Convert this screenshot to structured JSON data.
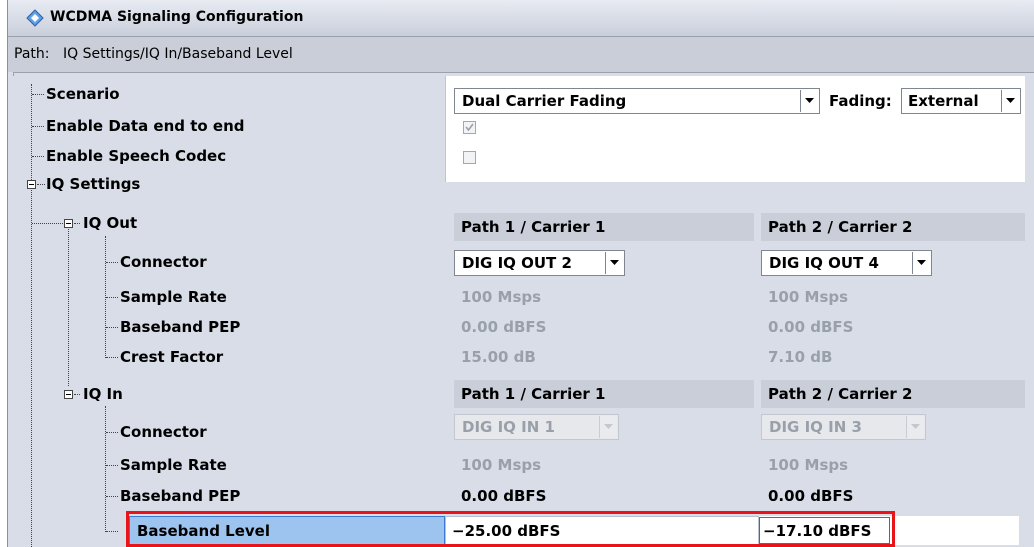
{
  "window": {
    "title": "WCDMA Signaling Configuration"
  },
  "path": {
    "label": "Path:",
    "value": "IQ Settings/IQ In/Baseband Level"
  },
  "tree": {
    "scenario": "Scenario",
    "enable_data": "Enable Data end to end",
    "enable_speech": "Enable Speech Codec",
    "iq_settings": "IQ Settings",
    "iq_out": "IQ Out",
    "connector": "Connector",
    "sample_rate": "Sample Rate",
    "baseband_pep": "Baseband PEP",
    "crest_factor": "Crest Factor",
    "iq_in": "IQ In",
    "baseband_level": "Baseband Level"
  },
  "scenario": {
    "value": "Dual Carrier Fading",
    "fading_label": "Fading:",
    "fading_value": "External"
  },
  "checks": {
    "enable_data": true,
    "enable_speech": false
  },
  "iq_out": {
    "headers": [
      "Path 1 / Carrier 1",
      "Path 2 / Carrier 2"
    ],
    "connector": [
      "DIG IQ OUT 2",
      "DIG IQ OUT 4"
    ],
    "sample_rate": [
      "100 Msps",
      "100 Msps"
    ],
    "baseband_pep": [
      "0.00 dBFS",
      "0.00 dBFS"
    ],
    "crest_factor": [
      "15.00 dB",
      "7.10 dB"
    ]
  },
  "iq_in": {
    "headers": [
      "Path 1 / Carrier 1",
      "Path 2 / Carrier 2"
    ],
    "connector": [
      "DIG IQ IN 1",
      "DIG IQ IN 3"
    ],
    "sample_rate": [
      "100 Msps",
      "100 Msps"
    ],
    "baseband_pep": [
      "0.00 dBFS",
      "0.00 dBFS"
    ],
    "baseband_level": [
      "−25.00 dBFS",
      "−17.10 dBFS"
    ]
  },
  "colors": {
    "highlight": "#e8141a",
    "focus": "#2e70c9"
  }
}
